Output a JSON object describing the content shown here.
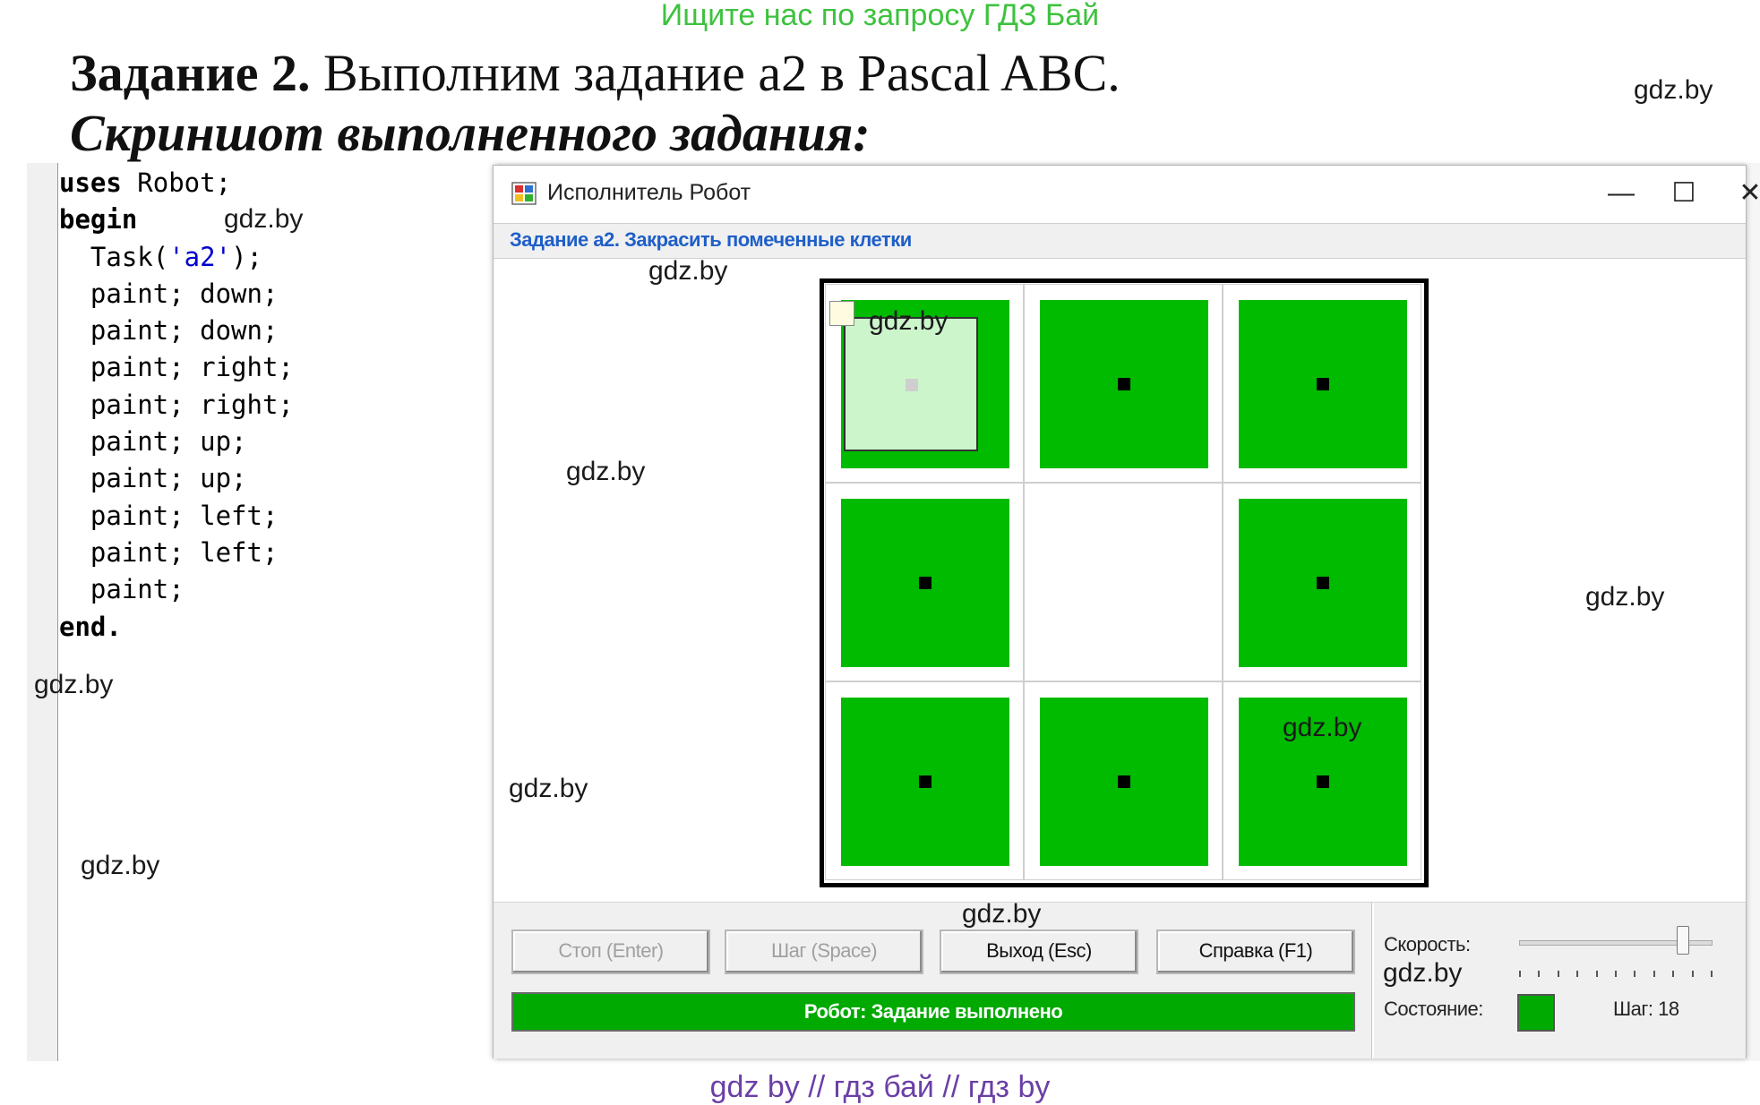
{
  "banner": "Ищите нас по запросу ГДЗ Бай",
  "heading": {
    "bold": "Задание 2.",
    "rest": " Выполним задание а2 в Pascal ABC.",
    "subtitle": "Скриншот выполненного задания:"
  },
  "code": {
    "line1_kw": "uses",
    "line1_rest": " Robot;",
    "line2": "begin",
    "line3_pre": "  Task(",
    "line3_str": "'a2'",
    "line3_post": ");",
    "line4": "  paint; down;",
    "line5": "  paint; down;",
    "line6": "  paint; right;",
    "line7": "  paint; right;",
    "line8": "  paint; up;",
    "line9": "  paint; up;",
    "line10": "  paint; left;",
    "line11": "  paint; left;",
    "line12": "  paint;",
    "line13": "end."
  },
  "window": {
    "title": "Исполнитель Робот",
    "minimize": "—",
    "maximize": "☐",
    "close": "✕",
    "task": "Задание а2. Закрасить помеченные клетки"
  },
  "grid": {
    "rows": 3,
    "cols": 3,
    "fill_color": "#00bb00",
    "robot_color": "#ccf5cc",
    "robot_cell": [
      0,
      0
    ],
    "painted": [
      [
        true,
        true,
        true
      ],
      [
        true,
        false,
        true
      ],
      [
        true,
        true,
        true
      ]
    ]
  },
  "controls": {
    "stop": "Стоп (Enter)",
    "step": "Шаг (Space)",
    "exit": "Выход (Esc)",
    "help": "Справка (F1)",
    "status": "Робот: Задание выполнено",
    "speed_label": "Скорость:",
    "state_label": "Состояние:",
    "step_count": "Шаг: 18",
    "speed_level": 0.85
  },
  "watermark": "gdz.by",
  "footer": "gdz by  //  гдз бай  //  гдз by"
}
